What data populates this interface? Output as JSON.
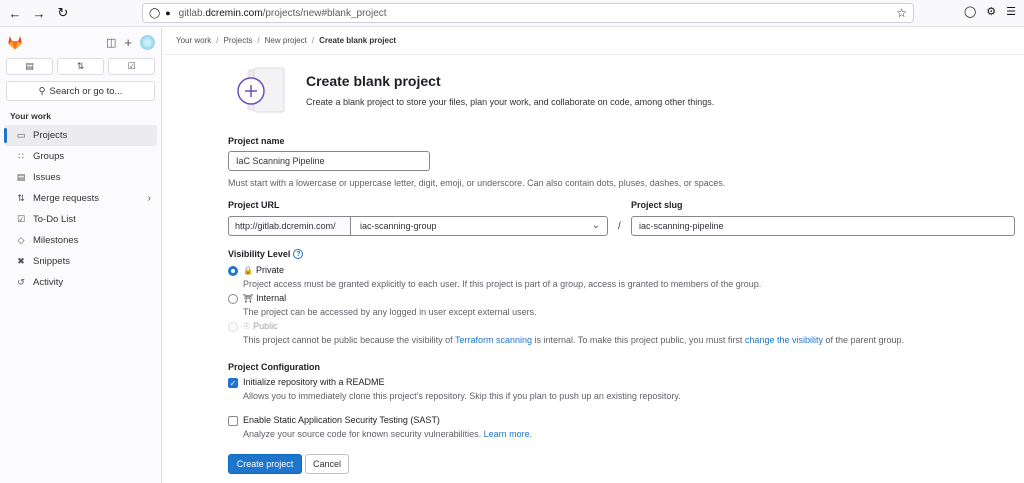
{
  "browser": {
    "url_prefix": "gitlab.",
    "url_domain": "dcremin.com",
    "url_path": "/projects/new#blank_project"
  },
  "sidebar": {
    "search": "Search or go to...",
    "section": "Your work",
    "items": [
      {
        "label": "Projects",
        "icon": "project-icon"
      },
      {
        "label": "Groups",
        "icon": "group-icon"
      },
      {
        "label": "Issues",
        "icon": "issues-icon"
      },
      {
        "label": "Merge requests",
        "icon": "merge-request-icon"
      },
      {
        "label": "To-Do List",
        "icon": "todo-icon"
      },
      {
        "label": "Milestones",
        "icon": "milestone-icon"
      },
      {
        "label": "Snippets",
        "icon": "snippet-icon"
      },
      {
        "label": "Activity",
        "icon": "activity-icon"
      }
    ]
  },
  "breadcrumb": {
    "items": [
      "Your work",
      "Projects",
      "New project",
      "Create blank project"
    ]
  },
  "header": {
    "title": "Create blank project",
    "subtitle": "Create a blank project to store your files, plan your work, and collaborate on code, among other things."
  },
  "form": {
    "project_name_label": "Project name",
    "project_name_value": "IaC Scanning Pipeline",
    "project_name_help": "Must start with a lowercase or uppercase letter, digit, emoji, or underscore. Can also contain dots, pluses, dashes, or spaces.",
    "project_url_label": "Project URL",
    "project_url_prefix": "http://gitlab.dcremin.com/",
    "project_group": "iac-scanning-group",
    "slash": "/",
    "project_slug_label": "Project slug",
    "project_slug_value": "iac-scanning-pipeline",
    "visibility_label": "Visibility Level",
    "private_label": "Private",
    "private_help": "Project access must be granted explicitly to each user. If this project is part of a group, access is granted to members of the group.",
    "internal_label": "Internal",
    "internal_help": "The project can be accessed by any logged in user except external users.",
    "public_label": "Public",
    "public_help_1": "This project cannot be public because the visibility of ",
    "public_help_link_1": "Terraform scanning",
    "public_help_2": " is internal. To make this project public, you must first ",
    "public_help_link_2": "change the visibility",
    "public_help_3": " of the parent group.",
    "config_label": "Project Configuration",
    "readme_label": "Initialize repository with a README",
    "readme_help": "Allows you to immediately clone this project’s repository. Skip this if you plan to push up an existing repository.",
    "sast_label": "Enable Static Application Security Testing (SAST)",
    "sast_help": "Analyze your source code for known security vulnerabilities. ",
    "sast_link": "Learn more.",
    "create_button": "Create project",
    "cancel_button": "Cancel",
    "visibility_selected": "Private",
    "readme_checked": true,
    "sast_checked": false
  },
  "colors": {
    "accent": "#1f75cb",
    "logo": "#e24329"
  }
}
